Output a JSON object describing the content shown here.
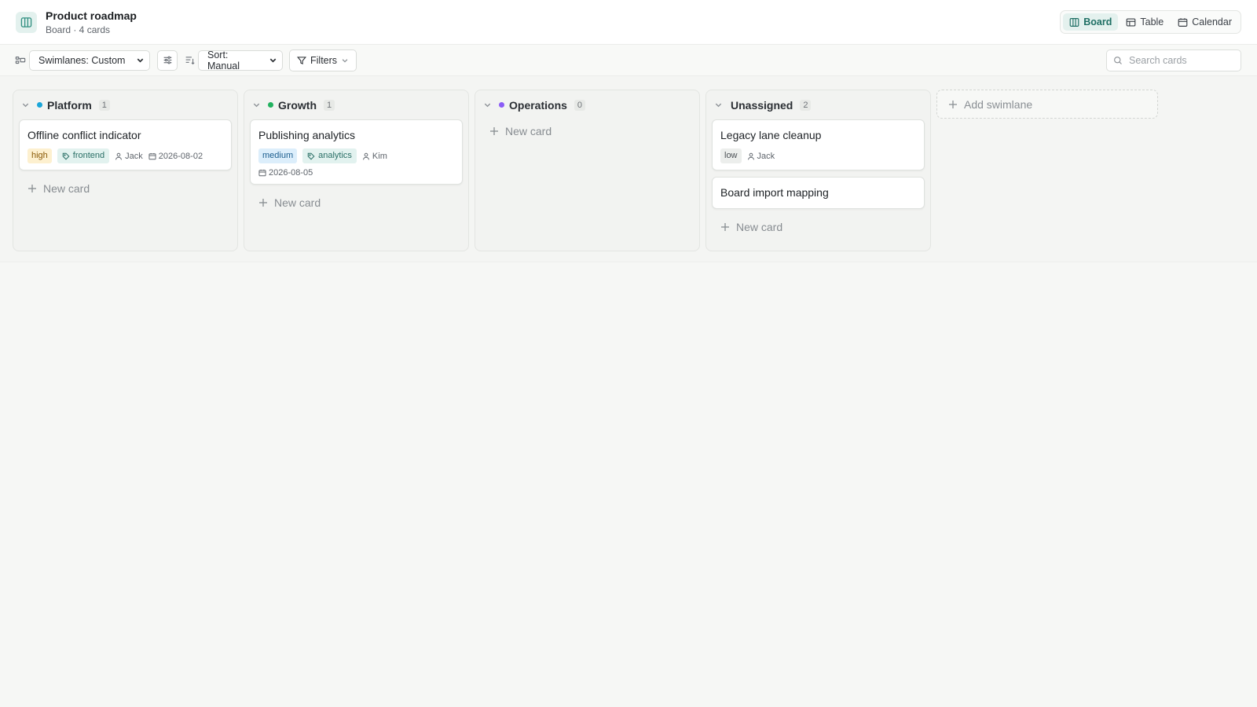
{
  "header": {
    "title": "Product roadmap",
    "subtitle": "Board · 4 cards",
    "views": [
      {
        "label": "Board",
        "icon": "board-icon",
        "active": true
      },
      {
        "label": "Table",
        "icon": "table-icon",
        "active": false
      },
      {
        "label": "Calendar",
        "icon": "calendar-icon",
        "active": false
      }
    ]
  },
  "toolbar": {
    "swimlanes_select": "Swimlanes: Custom",
    "sort_select": "Sort: Manual",
    "filters_label": "Filters",
    "search_placeholder": "Search cards"
  },
  "colors": {
    "accent": "#2f8f80",
    "platform": "#1aa6d9",
    "growth": "#22b25f",
    "operations": "#8b5cf6",
    "priority_high": "#fdf0cf",
    "priority_medium": "#dceefb"
  },
  "lanes": [
    {
      "name": "Platform",
      "count": "1",
      "dot": "#1aa6d9",
      "cards": [
        {
          "title": "Offline conflict indicator",
          "priority": "high",
          "tag": "frontend",
          "assignee": "Jack",
          "due": "2026-08-02"
        }
      ],
      "new_card": "New card"
    },
    {
      "name": "Growth",
      "count": "1",
      "dot": "#22b25f",
      "cards": [
        {
          "title": "Publishing analytics",
          "priority": "medium",
          "tag": "analytics",
          "assignee": "Kim",
          "due": "2026-08-05"
        }
      ],
      "new_card": "New card"
    },
    {
      "name": "Operations",
      "count": "0",
      "dot": "#8b5cf6",
      "cards": [],
      "new_card": "New card"
    },
    {
      "name": "Unassigned",
      "count": "2",
      "dot": null,
      "cards": [
        {
          "title": "Legacy lane cleanup",
          "priority": "low",
          "assignee": "Jack"
        },
        {
          "title": "Board import mapping"
        }
      ],
      "new_card": "New card"
    }
  ],
  "add_swimlane": "Add swimlane"
}
